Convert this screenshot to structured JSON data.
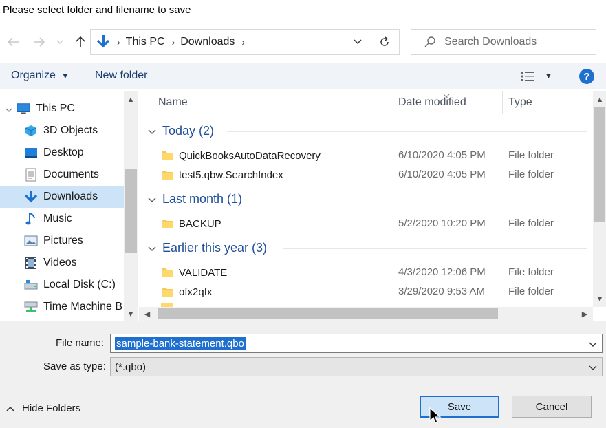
{
  "dialog": {
    "title": "Please select folder and filename to save"
  },
  "address": {
    "crumbs": [
      "This PC",
      "Downloads"
    ]
  },
  "search": {
    "placeholder": "Search Downloads"
  },
  "toolbar": {
    "organize_label": "Organize",
    "new_folder_label": "New folder",
    "help_label": "?"
  },
  "nav": {
    "items": [
      {
        "label": "This PC",
        "icon": "pc-icon"
      },
      {
        "label": "3D Objects",
        "icon": "cube-icon"
      },
      {
        "label": "Desktop",
        "icon": "desktop-icon"
      },
      {
        "label": "Documents",
        "icon": "document-icon"
      },
      {
        "label": "Downloads",
        "icon": "download-icon"
      },
      {
        "label": "Music",
        "icon": "music-icon"
      },
      {
        "label": "Pictures",
        "icon": "picture-icon"
      },
      {
        "label": "Videos",
        "icon": "video-icon"
      },
      {
        "label": "Local Disk (C:)",
        "icon": "disk-icon"
      },
      {
        "label": "Time Machine B",
        "icon": "network-drive-icon"
      }
    ],
    "selected": "Downloads"
  },
  "columns": {
    "name": "Name",
    "date": "Date modified",
    "type": "Type"
  },
  "groups": [
    {
      "label": "Today (2)",
      "files": [
        {
          "name": "QuickBooksAutoDataRecovery",
          "date": "6/10/2020 4:05 PM",
          "type": "File folder"
        },
        {
          "name": "test5.qbw.SearchIndex",
          "date": "6/10/2020 4:05 PM",
          "type": "File folder"
        }
      ]
    },
    {
      "label": "Last month (1)",
      "files": [
        {
          "name": "BACKUP",
          "date": "5/2/2020 10:20 PM",
          "type": "File folder"
        }
      ]
    },
    {
      "label": "Earlier this year (3)",
      "files": [
        {
          "name": "VALIDATE",
          "date": "4/3/2020 12:06 PM",
          "type": "File folder"
        },
        {
          "name": "ofx2qfx",
          "date": "3/29/2020 9:53 AM",
          "type": "File folder"
        }
      ]
    }
  ],
  "form": {
    "file_name_label": "File name:",
    "file_name_value": "sample-bank-statement.qbo",
    "save_type_label": "Save as type:",
    "save_type_value": "(*.qbo)"
  },
  "footer": {
    "hide_folders_label": "Hide Folders",
    "save_label": "Save",
    "cancel_label": "Cancel"
  },
  "colors": {
    "accent": "#1f6fcf",
    "selection": "#cde3f7",
    "group_text": "#1f4e9a"
  }
}
